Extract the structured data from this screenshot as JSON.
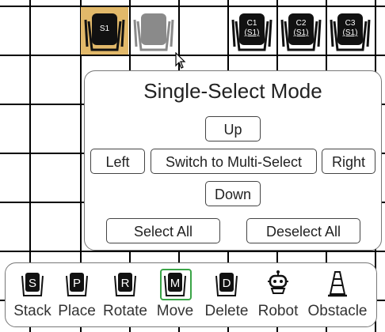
{
  "slots": [
    {
      "label": "S1",
      "sublabel": "",
      "state": "selected"
    },
    {
      "label": "",
      "sublabel": "",
      "state": "ghost"
    },
    {
      "label": "C1",
      "sublabel": "(S1)",
      "state": "normal"
    },
    {
      "label": "C2",
      "sublabel": "(S1)",
      "state": "normal"
    },
    {
      "label": "C3",
      "sublabel": "(S1)",
      "state": "normal"
    }
  ],
  "panel": {
    "title": "Single-Select Mode",
    "up": "Up",
    "left": "Left",
    "switch": "Switch to Multi-Select",
    "right": "Right",
    "down": "Down",
    "select_all": "Select All",
    "deselect_all": "Deselect All"
  },
  "toolbar": [
    {
      "label": "Stack",
      "glyph": "S",
      "icon": "stack-icon"
    },
    {
      "label": "Place",
      "glyph": "P",
      "icon": "place-icon"
    },
    {
      "label": "Rotate",
      "glyph": "R",
      "icon": "rotate-icon"
    },
    {
      "label": "Move",
      "glyph": "M",
      "icon": "move-icon",
      "active": true
    },
    {
      "label": "Delete",
      "glyph": "D",
      "icon": "delete-icon"
    },
    {
      "label": "Robot",
      "glyph": "",
      "icon": "robot-icon"
    },
    {
      "label": "Obstacle",
      "glyph": "",
      "icon": "obstacle-icon"
    }
  ],
  "colors": {
    "selected": "#e2b96a",
    "active_tool": "#3aa447",
    "ghost": "#8a8a8a"
  }
}
